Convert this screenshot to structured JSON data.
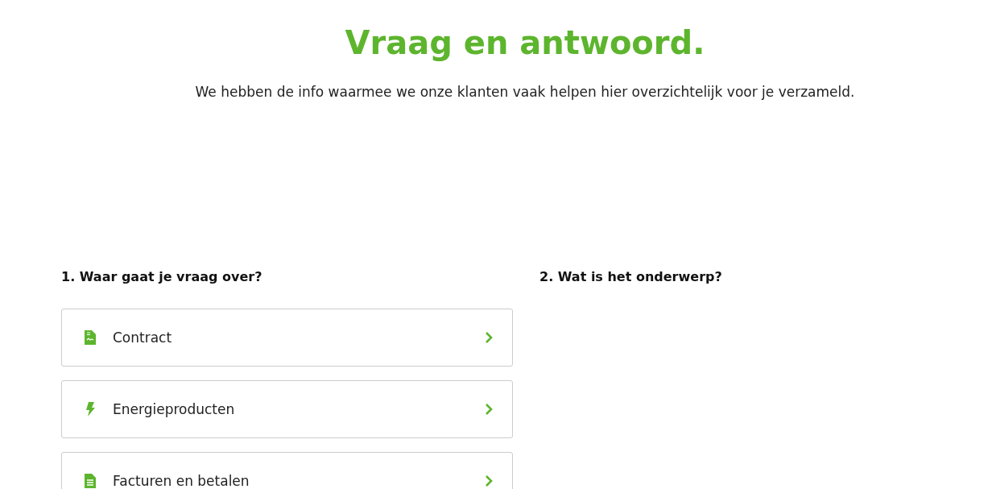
{
  "title": "Vraag en antwoord.",
  "intro": "We hebben de info waarmee we onze klanten vaak helpen hier overzichtelijk voor je verzameld.",
  "step_1": {
    "heading": "1. Waar gaat je vraag over?",
    "items": [
      {
        "label": "Contract",
        "kind": "contract"
      },
      {
        "label": "Energieproducten",
        "kind": "energy"
      },
      {
        "label": "Facturen en betalen",
        "kind": "invoice"
      }
    ]
  },
  "step_2": {
    "heading": "2. Wat is het onderwerp?"
  }
}
